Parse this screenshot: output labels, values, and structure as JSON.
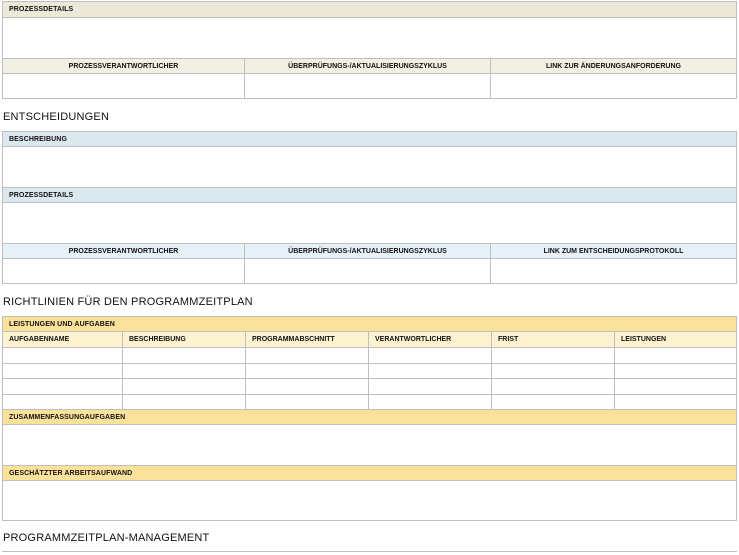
{
  "section_top": {
    "header": "PROZESSDETAILS",
    "columns": [
      "PROZESSVERANTWORTLICHER",
      "ÜBERPRÜFUNGS-/AKTUALISIERUNGSZYKLUS",
      "LINK ZUR ÄNDERUNGSANFORDERUNG"
    ]
  },
  "entscheidungen": {
    "title": "ENTSCHEIDUNGEN",
    "description_header": "BESCHREIBUNG",
    "process_header": "PROZESSDETAILS",
    "columns": [
      "PROZESSVERANTWORTLICHER",
      "ÜBERPRÜFUNGS-/AKTUALISIERUNGSZYKLUS",
      "LINK ZUM ENTSCHEIDUNGSPROTOKOLL"
    ]
  },
  "richtlinien": {
    "title": "RICHTLINIEN FÜR DEN PROGRAMMZEITPLAN",
    "tasks_header": "LEISTUNGEN UND AUFGABEN",
    "columns": [
      "AUFGABENNAME",
      "BESCHREIBUNG",
      "PROGRAMMABSCHNITT",
      "VERANTWORTLICHER",
      "FRIST",
      "LEISTUNGEN"
    ],
    "summary_header": "ZUSAMMENFASSUNGAUFGABEN",
    "effort_header": "GESCHÄTZTER ARBEITSAUFWAND"
  },
  "management": {
    "title": "PROGRAMMZEITPLAN-MANAGEMENT"
  },
  "colors": {
    "beige": "#ece9d8",
    "blue": "#dbe8ee",
    "yellow": "#fbe29a",
    "border": "#bfbfbf"
  }
}
